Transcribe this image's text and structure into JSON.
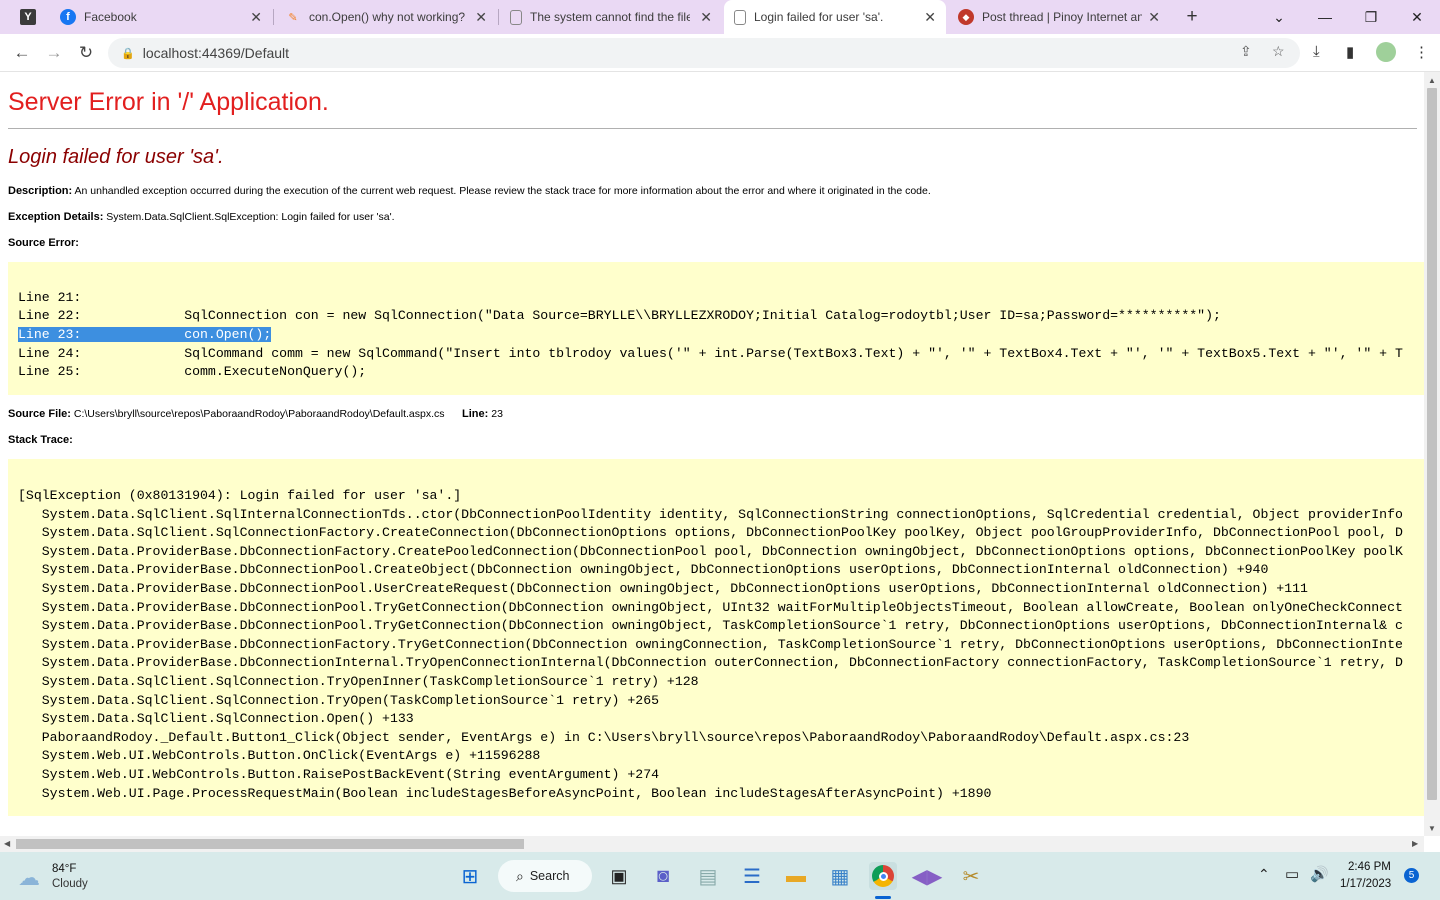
{
  "browser": {
    "tabs": [
      {
        "title": "Facebook",
        "icon": "facebook-icon"
      },
      {
        "title": "con.Open() why not working?",
        "icon": "stackoverflow-icon"
      },
      {
        "title": "The system cannot find the file",
        "icon": "page-icon"
      },
      {
        "title": "Login failed for user 'sa'.",
        "icon": "page-icon"
      },
      {
        "title": "Post thread | Pinoy Internet and",
        "icon": "forum-icon"
      }
    ],
    "url": "localhost:44369/Default"
  },
  "page": {
    "server_error": "Server Error in '/' Application.",
    "error_title": "Login failed for user 'sa'.",
    "description_label": "Description:",
    "description_text": "An unhandled exception occurred during the execution of the current web request. Please review the stack trace for more information about the error and where it originated in the code.",
    "exception_label": "Exception Details:",
    "exception_text": "System.Data.SqlClient.SqlException: Login failed for user 'sa'.",
    "source_error_label": "Source Error:",
    "source_lines": [
      "Line 21:",
      "Line 22:             SqlConnection con = new SqlConnection(\"Data Source=BRYLLE\\\\BRYLLEZXRODOY;Initial Catalog=rodoytbl;User ID=sa;Password=**********\");",
      "Line 23:             con.Open();",
      "Line 24:             SqlCommand comm = new SqlCommand(\"Insert into tblrodoy values('\" + int.Parse(TextBox3.Text) + \"', '\" + TextBox4.Text + \"', '\" + TextBox5.Text + \"', '\" + T",
      "Line 25:             comm.ExecuteNonQuery();"
    ],
    "source_file_label": "Source File:",
    "source_file": "C:\\Users\\bryll\\source\\repos\\PaboraandRodoy\\PaboraandRodoy\\Default.aspx.cs",
    "line_label": "Line:",
    "line_number": "23",
    "stack_trace_label": "Stack Trace:",
    "stack_trace": [
      "[SqlException (0x80131904): Login failed for user 'sa'.]",
      "   System.Data.SqlClient.SqlInternalConnectionTds..ctor(DbConnectionPoolIdentity identity, SqlConnectionString connectionOptions, SqlCredential credential, Object providerInfo",
      "   System.Data.SqlClient.SqlConnectionFactory.CreateConnection(DbConnectionOptions options, DbConnectionPoolKey poolKey, Object poolGroupProviderInfo, DbConnectionPool pool, D",
      "   System.Data.ProviderBase.DbConnectionFactory.CreatePooledConnection(DbConnectionPool pool, DbConnection owningObject, DbConnectionOptions options, DbConnectionPoolKey poolK",
      "   System.Data.ProviderBase.DbConnectionPool.CreateObject(DbConnection owningObject, DbConnectionOptions userOptions, DbConnectionInternal oldConnection) +940",
      "   System.Data.ProviderBase.DbConnectionPool.UserCreateRequest(DbConnection owningObject, DbConnectionOptions userOptions, DbConnectionInternal oldConnection) +111",
      "   System.Data.ProviderBase.DbConnectionPool.TryGetConnection(DbConnection owningObject, UInt32 waitForMultipleObjectsTimeout, Boolean allowCreate, Boolean onlyOneCheckConnect",
      "   System.Data.ProviderBase.DbConnectionPool.TryGetConnection(DbConnection owningObject, TaskCompletionSource`1 retry, DbConnectionOptions userOptions, DbConnectionInternal& c",
      "   System.Data.ProviderBase.DbConnectionFactory.TryGetConnection(DbConnection owningConnection, TaskCompletionSource`1 retry, DbConnectionOptions userOptions, DbConnectionInte",
      "   System.Data.ProviderBase.DbConnectionInternal.TryOpenConnectionInternal(DbConnection outerConnection, DbConnectionFactory connectionFactory, TaskCompletionSource`1 retry, D",
      "   System.Data.SqlClient.SqlConnection.TryOpenInner(TaskCompletionSource`1 retry) +128",
      "   System.Data.SqlClient.SqlConnection.TryOpen(TaskCompletionSource`1 retry) +265",
      "   System.Data.SqlClient.SqlConnection.Open() +133",
      "   PaboraandRodoy._Default.Button1_Click(Object sender, EventArgs e) in C:\\Users\\bryll\\source\\repos\\PaboraandRodoy\\PaboraandRodoy\\Default.aspx.cs:23",
      "   System.Web.UI.WebControls.Button.OnClick(EventArgs e) +11596288",
      "   System.Web.UI.WebControls.Button.RaisePostBackEvent(String eventArgument) +274",
      "   System.Web.UI.Page.ProcessRequestMain(Boolean includeStagesBeforeAsyncPoint, Boolean includeStagesAfterAsyncPoint) +1890"
    ],
    "colors": {
      "title_red": "#e21f1f",
      "subtitle_maroon": "#8b0000",
      "code_bg": "#ffffcc",
      "highlight": "#3d8fe0"
    }
  },
  "taskbar": {
    "weather_temp": "84°F",
    "weather_desc": "Cloudy",
    "search_label": "Search",
    "time": "2:46 PM",
    "date": "1/17/2023",
    "notification_count": "5"
  }
}
